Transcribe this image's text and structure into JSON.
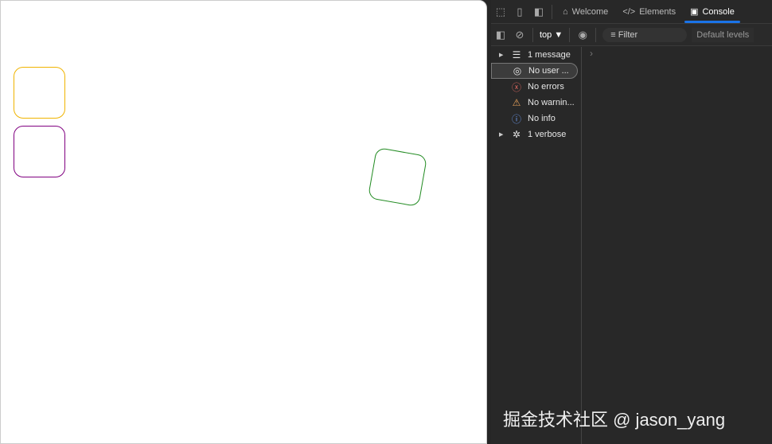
{
  "page": {
    "boxes": [
      {
        "color": "#f0b400"
      },
      {
        "color": "#800080"
      },
      {
        "color": "#228b22",
        "rotation_deg": 10
      }
    ]
  },
  "devtools": {
    "tabs": [
      {
        "label": "Welcome",
        "icon": "home-icon"
      },
      {
        "label": "Elements",
        "icon": "code-icon"
      },
      {
        "label": "Console",
        "icon": "console-icon",
        "active": true
      }
    ],
    "context": "top",
    "filter_placeholder": "Filter",
    "levels": "Default levels",
    "sidebar": [
      {
        "label": "1 message",
        "icon": "list-icon",
        "expandable": true
      },
      {
        "label": "No user ...",
        "icon": "user-icon",
        "selected": true
      },
      {
        "label": "No errors",
        "icon": "error-icon"
      },
      {
        "label": "No warnin...",
        "icon": "warning-icon"
      },
      {
        "label": "No info",
        "icon": "info-icon"
      },
      {
        "label": "1 verbose",
        "icon": "bug-icon",
        "expandable": true
      }
    ],
    "prompt": "›"
  },
  "watermark": "掘金技术社区 @ jason_yang"
}
